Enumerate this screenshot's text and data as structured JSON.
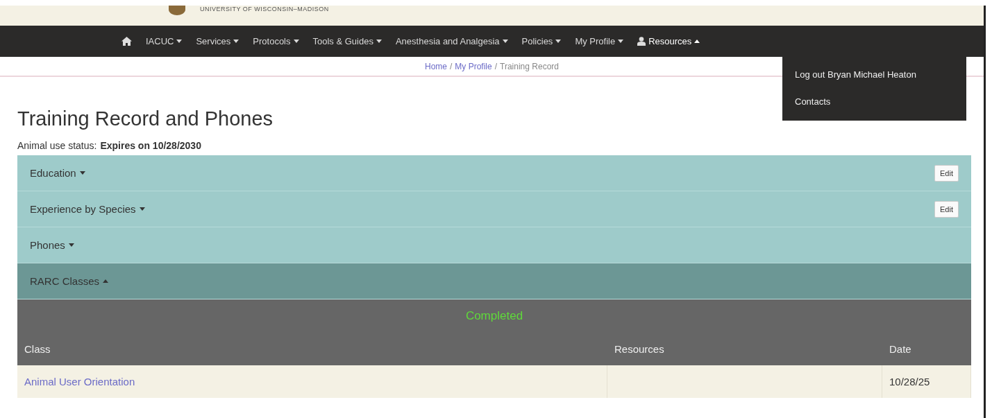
{
  "header": {
    "institution": "UNIVERSITY OF WISCONSIN–MADISON"
  },
  "nav": {
    "items": [
      {
        "kind": "home"
      },
      {
        "kind": "menu",
        "label": "IACUC",
        "expanded": false
      },
      {
        "kind": "menu",
        "label": "Services",
        "expanded": false
      },
      {
        "kind": "menu",
        "label": "Protocols",
        "expanded": false
      },
      {
        "kind": "menu",
        "label": "Tools & Guides",
        "expanded": false
      },
      {
        "kind": "menu",
        "label": "Anesthesia and Analgesia",
        "expanded": false
      },
      {
        "kind": "menu",
        "label": "Policies",
        "expanded": false
      },
      {
        "kind": "menu",
        "label": "My Profile",
        "expanded": false
      },
      {
        "kind": "user",
        "label": "Resources",
        "expanded": true
      }
    ],
    "dropdown": [
      "Log out Bryan Michael Heaton",
      "Contacts"
    ]
  },
  "breadcrumb": {
    "links": [
      "Home",
      "My Profile"
    ],
    "separator": "/",
    "current": "Training Record"
  },
  "page": {
    "title": "Training Record and Phones",
    "status_label": "Animal use status:",
    "status_value": "Expires on 10/28/2030"
  },
  "panels": [
    {
      "title": "Education",
      "expanded": false,
      "edit_button": "Edit"
    },
    {
      "title": "Experience by Species",
      "expanded": false,
      "edit_button": "Edit"
    },
    {
      "title": "Phones",
      "expanded": false
    },
    {
      "title": "RARC Classes",
      "expanded": true
    }
  ],
  "classes": {
    "heading": "Completed",
    "columns": [
      "Class",
      "Resources",
      "Date"
    ],
    "rows": [
      {
        "class": "Animal User Orientation",
        "date": "10/28/25"
      }
    ]
  }
}
